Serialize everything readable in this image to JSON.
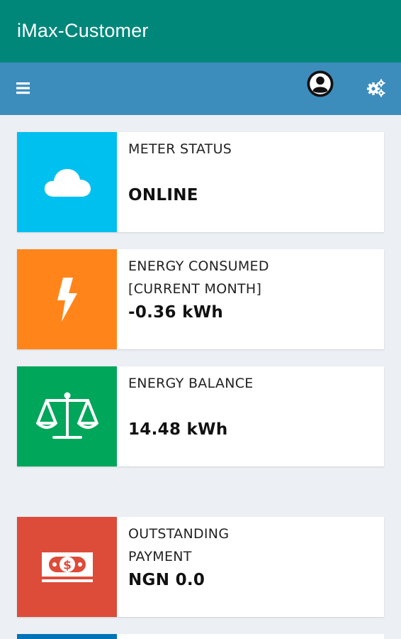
{
  "app": {
    "title": "iMax-Customer"
  },
  "toolbar": {
    "menu_icon": "hamburger-menu-icon",
    "profile_icon": "user-avatar-icon",
    "settings_icon": "gears-icon"
  },
  "cards": [
    {
      "label": "METER STATUS",
      "value": "ONLINE",
      "icon": "cloud-icon",
      "color": "#00c0ef"
    },
    {
      "label_line1": "ENERGY CONSUMED",
      "label_line2": "[CURRENT MONTH]",
      "value": "-0.36 kWh",
      "icon": "lightning-bolt-icon",
      "color": "#ff851b"
    },
    {
      "label": "ENERGY BALANCE",
      "value": "14.48 kWh",
      "icon": "balance-scale-icon",
      "color": "#00a65a"
    },
    {
      "label_line1": "OUTSTANDING",
      "label_line2": "PAYMENT",
      "value": "NGN 0.0",
      "icon": "money-bill-icon",
      "color": "#dd4b39"
    }
  ],
  "colors": {
    "app_bar": "#00877a",
    "toolbar": "#3c8dbc",
    "background": "#eceff4",
    "partial_card": "#0073b7"
  }
}
